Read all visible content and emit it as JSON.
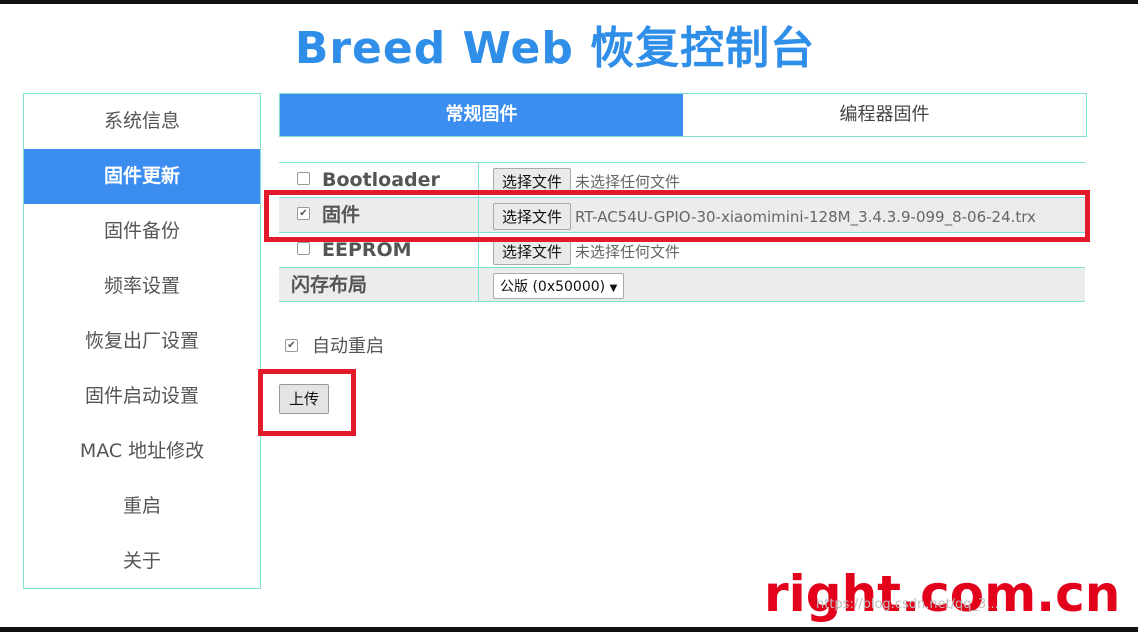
{
  "page": {
    "title": "Breed Web 恢复控制台"
  },
  "sidebar": {
    "items": [
      {
        "label": "系统信息",
        "active": false
      },
      {
        "label": "固件更新",
        "active": true
      },
      {
        "label": "固件备份",
        "active": false
      },
      {
        "label": "频率设置",
        "active": false
      },
      {
        "label": "恢复出厂设置",
        "active": false
      },
      {
        "label": "固件启动设置",
        "active": false
      },
      {
        "label": "MAC 地址修改",
        "active": false
      },
      {
        "label": "重启",
        "active": false
      },
      {
        "label": "关于",
        "active": false
      }
    ]
  },
  "tabs": [
    {
      "label": "常规固件",
      "active": true
    },
    {
      "label": "编程器固件",
      "active": false
    }
  ],
  "form": {
    "rows": [
      {
        "label": "Bootloader",
        "checked": false,
        "button": "选择文件",
        "status": "未选择任何文件"
      },
      {
        "label": "固件",
        "checked": true,
        "button": "选择文件",
        "status": "RT-AC54U-GPIO-30-xiaomimini-128M_3.4.3.9-099_8-06-24.trx"
      },
      {
        "label": "EEPROM",
        "checked": false,
        "button": "选择文件",
        "status": "未选择任何文件"
      }
    ],
    "flash_layout": {
      "label": "闪存布局",
      "selected": "公版 (0x50000)"
    }
  },
  "auto_reboot": {
    "label": "自动重启",
    "checked": true
  },
  "upload_button": "上传",
  "watermark": {
    "text": "right.com.cn",
    "url_overlay": "https://blog.csdn.net/qq_3..."
  },
  "colors": {
    "accent": "#3b8ef0",
    "border": "#7fe3d4",
    "annotation": "#e21b2c",
    "watermark": "#e3001b"
  }
}
